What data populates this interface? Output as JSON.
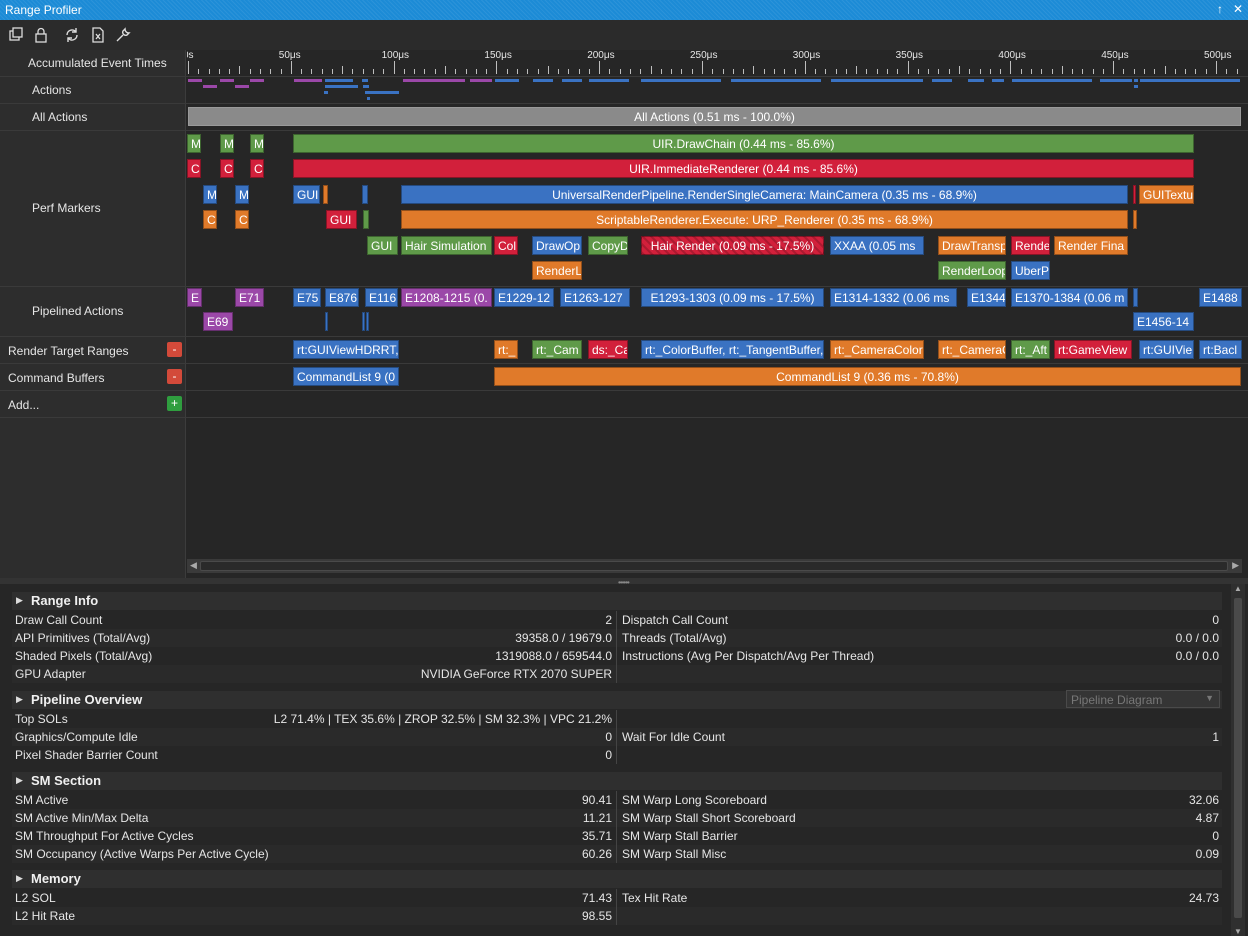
{
  "window": {
    "title": "Range Profiler",
    "pin_glyph": "↑",
    "close_glyph": "✕"
  },
  "toolbar": {
    "icons": [
      "copy-icon",
      "lock-icon",
      "refresh-icon",
      "export-icon",
      "wrench-icon"
    ]
  },
  "ruler": {
    "label": "Accumulated Event Times",
    "ticks": [
      "0s",
      "50μs",
      "100μs",
      "150μs",
      "200μs",
      "250μs",
      "300μs",
      "350μs",
      "400μs",
      "450μs",
      "500μs"
    ]
  },
  "tracks": {
    "actions": "Actions",
    "all_actions": "All Actions",
    "perf_markers": "Perf Markers",
    "pipelined_actions": "Pipelined Actions",
    "render_target_ranges": "Render Target Ranges",
    "command_buffers": "Command Buffers",
    "add": "Add...",
    "minus": "-",
    "plus": "+"
  },
  "bars": {
    "all_actions": "All Actions (0.51 ms - 100.0%)",
    "drawchain": "UIR.DrawChain (0.44 ms - 85.6%)",
    "immediate": "UIR.ImmediateRenderer (0.44 ms - 85.6%)",
    "urp_single": "UniversalRenderPipeline.RenderSingleCamera: MainCamera (0.35 ms - 68.9%)",
    "scriptable": "ScriptableRenderer.Execute: URP_Renderer (0.35 ms - 68.9%)",
    "gui_textu": "GUITextu",
    "gui_a": "GUI",
    "gui_b": "GUI",
    "gui_c": "GUI",
    "hair_sim": "Hair Simulation",
    "col": "Col",
    "drawop": "DrawOp",
    "copyd": "CopyD",
    "hair_render": "Hair Render (0.09 ms - 17.5%)",
    "xxaa": "XXAA (0.05 ms",
    "drawtransp": "DrawTransp",
    "rende": "Rende",
    "render_fina": "Render Fina",
    "renderl": "RenderL",
    "renderloop": "RenderLoop",
    "uberp": "UberP",
    "m": "M",
    "c": "C",
    "e_small": "E",
    "e71": "E71",
    "e69": "E69",
    "e75": "E75",
    "e876": "E876",
    "e116": "E116",
    "e1208": "E1208-1215 (0.",
    "e1229": "E1229-12",
    "e1263": "E1263-127",
    "e1293": "E1293-1303 (0.09 ms - 17.5%)",
    "e1314": "E1314-1332 (0.06 ms",
    "e1344": "E1344",
    "e1370": "E1370-1384 (0.06 m",
    "e1488": "E1488",
    "e1456": "E1456-14",
    "rt_guiviewhdrrt": "rt:GUIViewHDRRT,",
    "rt_": "rt:_",
    "rt_cam": "rt:_Cam",
    "ds_ca": "ds:_Ca",
    "rt_colorbuffer": "rt:_ColorBuffer, rt:_TangentBuffer,",
    "rt_cameracolor": "rt:_CameraColor",
    "rt_camerac": "rt:_CameraC",
    "rt_aft": "rt:_Aft",
    "rt_gameview": "rt:GameView",
    "rt_guivie": "rt:GUIVie",
    "rt_bacl": "rt:Bacl",
    "cmdlist_a": "CommandList 9 (0",
    "cmdlist_b": "CommandList 9 (0.36 ms - 70.8%)"
  },
  "range_info": {
    "title": "Range Info",
    "rows": [
      {
        "lk": "Draw Call Count",
        "lv": "2",
        "rk": "Dispatch Call Count",
        "rv": "0"
      },
      {
        "lk": "API Primitives (Total/Avg)",
        "lv": "39358.0 / 19679.0",
        "rk": "Threads (Total/Avg)",
        "rv": "0.0 / 0.0"
      },
      {
        "lk": "Shaded Pixels (Total/Avg)",
        "lv": "1319088.0 / 659544.0",
        "rk": "Instructions (Avg Per Dispatch/Avg Per Thread)",
        "rv": "0.0 / 0.0"
      },
      {
        "lk": "GPU Adapter",
        "lv": "NVIDIA GeForce RTX 2070 SUPER",
        "rk": "",
        "rv": ""
      }
    ]
  },
  "pipeline_overview": {
    "title": "Pipeline Overview",
    "dropdown": "Pipeline Diagram",
    "rows": [
      {
        "lk": "Top SOLs",
        "lv": "L2 71.4% | TEX 35.6% | ZROP 32.5% | SM 32.3% | VPC 21.2%",
        "rk": "",
        "rv": ""
      },
      {
        "lk": "Graphics/Compute Idle",
        "lv": "0",
        "rk": "Wait For Idle Count",
        "rv": "1"
      },
      {
        "lk": "Pixel Shader Barrier Count",
        "lv": "0",
        "rk": "",
        "rv": ""
      }
    ]
  },
  "sm_section": {
    "title": "SM Section",
    "rows": [
      {
        "lk": "SM Active",
        "lv": "90.41",
        "rk": "SM Warp Long Scoreboard",
        "rv": "32.06"
      },
      {
        "lk": "SM Active Min/Max Delta",
        "lv": "11.21",
        "rk": "SM Warp Stall Short Scoreboard",
        "rv": "4.87"
      },
      {
        "lk": "SM Throughput For Active Cycles",
        "lv": "35.71",
        "rk": "SM Warp Stall Barrier",
        "rv": "0"
      },
      {
        "lk": "SM Occupancy (Active Warps Per Active Cycle)",
        "lv": "60.26",
        "rk": "SM Warp Stall Misc",
        "rv": "0.09"
      }
    ]
  },
  "memory": {
    "title": "Memory",
    "rows": [
      {
        "lk": "L2 SOL",
        "lv": "71.43",
        "rk": "Tex Hit Rate",
        "rv": "24.73"
      },
      {
        "lk": "L2 Hit Rate",
        "lv": "98.55",
        "rk": "",
        "rv": ""
      }
    ]
  },
  "colors": {
    "title_bar": "#1c8bd6",
    "green": "#5f9a49",
    "red": "#d2203b",
    "blue": "#3a72c2",
    "orange": "#e07a2a",
    "purple": "#9b48a8"
  }
}
